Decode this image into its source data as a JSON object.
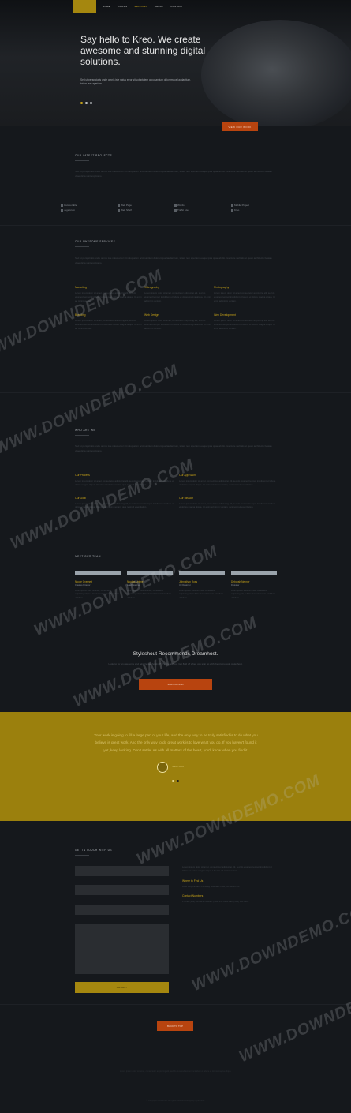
{
  "nav": {
    "links": [
      "HOME",
      "WORKS",
      "SERVICES",
      "ABOUT",
      "CONTACT"
    ],
    "active_index": 2
  },
  "hero": {
    "headline": "Say hello to Kreo. We create awesome and stunning digital solutions.",
    "subtext": "Sed ut perspiciatis unde omnis iste natus error sit voluptatem accusantium doloremque laudantium, totam rem aperiam.",
    "cta": "VIEW OUR WORK",
    "slides": 3,
    "active_slide": 0
  },
  "projects": {
    "title": "OUR LATEST PROJECTS",
    "intro": "Sed ut perspiciatis unde omnis iste natus error sit voluptatem accusantium doloremque laudantium, totam rem aperiam, eaque ipsa quae ab illo inventore veritatis et quasi architecto beatae vitae dicta sunt explicabo.",
    "filters": [
      "Outdoorable",
      "Web Page",
      "Words",
      "Mobile Project",
      "Jugaforum",
      "Web Shelf",
      "Traffic Lite",
      "Kreo"
    ]
  },
  "services": {
    "title": "OUR AWESOME SERVICES",
    "intro": "Sed ut perspiciatis unde omnis iste natus error sit voluptatem accusantium doloremque laudantium, totam rem aperiam, eaque ipsa quae ab illo inventore veritatis et quasi architecto beatae vitae dicta sunt explicabo.",
    "items": [
      {
        "title": "Marketing",
        "text": "Lorem ipsum dolor sit amet, consectetur adipiscing elit, sed do eiusmod tempor incididunt ut labore et dolore magna aliqua. Ut enim ad minim veniam."
      },
      {
        "title": "Videography",
        "text": "Lorem ipsum dolor sit amet, consectetur adipiscing elit, sed do eiusmod tempor incididunt ut labore et dolore magna aliqua. Ut enim ad minim veniam."
      },
      {
        "title": "Photography",
        "text": "Lorem ipsum dolor sit amet, consectetur adipiscing elit, sed do eiusmod tempor incididunt ut labore et dolore magna aliqua. Ut enim ad minim veniam."
      },
      {
        "title": "Branding",
        "text": "Lorem ipsum dolor sit amet, consectetur adipiscing elit, sed do eiusmod tempor incididunt ut labore et dolore magna aliqua. Ut enim ad minim veniam."
      },
      {
        "title": "Web Design",
        "text": "Lorem ipsum dolor sit amet, consectetur adipiscing elit, sed do eiusmod tempor incididunt ut labore et dolore magna aliqua. Ut enim ad minim veniam."
      },
      {
        "title": "Web Development",
        "text": "Lorem ipsum dolor sit amet, consectetur adipiscing elit, sed do eiusmod tempor incididunt ut labore et dolore magna aliqua. Ut enim ad minim veniam."
      }
    ]
  },
  "about": {
    "title": "WHO ARE WE",
    "intro": "Sed ut perspiciatis unde omnis iste natus error sit voluptatem accusantium doloremque laudantium, totam rem aperiam, eaque ipsa quae ab illo inventore veritatis et quasi architecto beatae vitae dicta sunt explicabo.",
    "items": [
      {
        "title": "Our Process",
        "text": "Lorem ipsum dolor sit amet, consectetur adipiscing elit, sed do eiusmod tempor incididunt ut labore et dolore magna aliqua. Ut enim ad minim veniam, quis nostrud exercitation."
      },
      {
        "title": "Our Approach",
        "text": "Lorem ipsum dolor sit amet, consectetur adipiscing elit, sed do eiusmod tempor incididunt ut labore et dolore magna aliqua. Ut enim ad minim veniam, quis nostrud exercitation."
      },
      {
        "title": "Our Goal",
        "text": "Lorem ipsum dolor sit amet, consectetur adipiscing elit, sed do eiusmod tempor incididunt ut labore et dolore magna aliqua. Ut enim ad minim veniam, quis nostrud exercitation."
      },
      {
        "title": "Our Mission",
        "text": "Lorem ipsum dolor sit amet, consectetur adipiscing elit, sed do eiusmod tempor incididunt ut labore et dolore magna aliqua. Ut enim ad minim veniam, quis nostrud exercitation."
      }
    ]
  },
  "team": {
    "title": "MEET OUR TEAM",
    "members": [
      {
        "name": "Nicole Overnett",
        "role": "Creative Director",
        "text": "Lorem ipsum dolor sit amet, consectetur adipiscing elit, sed do eiusmod tempor incididunt ut labore."
      },
      {
        "name": "Nicolas Unfine",
        "role": "Lead Designer",
        "text": "Lorem ipsum dolor sit amet, consectetur adipiscing elit, sed do eiusmod tempor incididunt ut labore."
      },
      {
        "name": "Johnathan Ross",
        "role": "UX Designer",
        "text": "Lorem ipsum dolor sit amet, consectetur adipiscing elit, sed do eiusmod tempor incididunt ut labore."
      },
      {
        "name": "Deborah Nenner",
        "role": "Designer",
        "text": "Lorem ipsum dolor sit amet, consectetur adipiscing elit, sed do eiusmod tempor incididunt ut labore."
      }
    ]
  },
  "promo": {
    "title": "Styleshout Recommends Dreamhost.",
    "text": "Looking for an awesome and reliable webhosting? Try Dreamhost. Get $50 off when you sign up with the promocode styleshout.",
    "cta": "SIGN UP NOW"
  },
  "testimonial": {
    "quote": "Your work is going to fill a large part of your life, and the only way to be truly satisfied is to do what you believe is great work. And the only way to do great work is to love what you do. If you haven't found it yet, keep looking. Don't settle. As with all matters of the heart, you'll know when you find it.",
    "author": "Steve Jobs",
    "slides": 2,
    "active_slide": 1
  },
  "contact": {
    "title": "GET IN TOUCH WITH US",
    "fields": [
      {
        "placeholder": "Name"
      },
      {
        "placeholder": "Email"
      },
      {
        "placeholder": "Subject"
      },
      {
        "placeholder": "Message"
      }
    ],
    "submit": "SUBMIT",
    "info_text": "Lorem ipsum dolor sit amet, consectetur adipiscing elit, sed do eiusmod tempor incididunt ut labore et dolore magna aliqua. Ut enim ad minim veniam.",
    "where_title": "Where to Find Us",
    "address": "1600 Amphitheatre Parkway Mountain View, CA 94043 US",
    "phone_title": "Contact Numbers",
    "phones": "Phone: (+63) 555 1212 Mobile: (+63) 555 0100 Fax: (+63) 555 0101"
  },
  "back_to_top": "BACK TO TOP",
  "footer": {
    "text": "Lorem ipsum dolor sit amet, consectetur adipiscing elit, sed do eiusmod tempor incididunt ut labore et dolore magna aliqua.",
    "copyright": "© Copyright Kreo 2014. All rights reserved. Design by styleshout."
  },
  "watermark": "WWW.DOWNDEMO.COM",
  "colors": {
    "accent": "#c9a418",
    "cta": "#b8440f",
    "band": "#9b800d",
    "bg": "#15181c"
  }
}
